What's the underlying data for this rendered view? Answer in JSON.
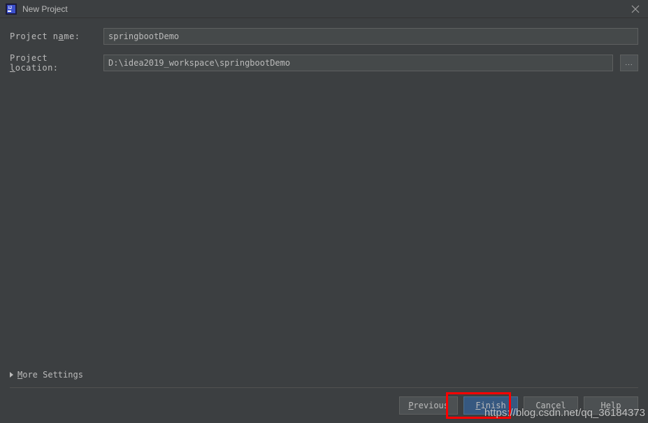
{
  "window": {
    "title": "New Project"
  },
  "form": {
    "projectName": {
      "label_pre": "Project n",
      "label_mn": "a",
      "label_post": "me:",
      "value": "springbootDemo"
    },
    "projectLocation": {
      "label_pre": "Project ",
      "label_mn": "l",
      "label_post": "ocation:",
      "value": "D:\\idea2019_workspace\\springbootDemo",
      "browseLabel": "..."
    }
  },
  "moreSettings": {
    "label_mn": "M",
    "label_post": "ore Settings"
  },
  "buttons": {
    "previous_mn": "P",
    "previous_post": "revious",
    "finish_mn": "F",
    "finish_post": "inish",
    "cancel": "Cancel",
    "help": "Help"
  },
  "watermark": "https://blog.csdn.net/qq_36184373"
}
